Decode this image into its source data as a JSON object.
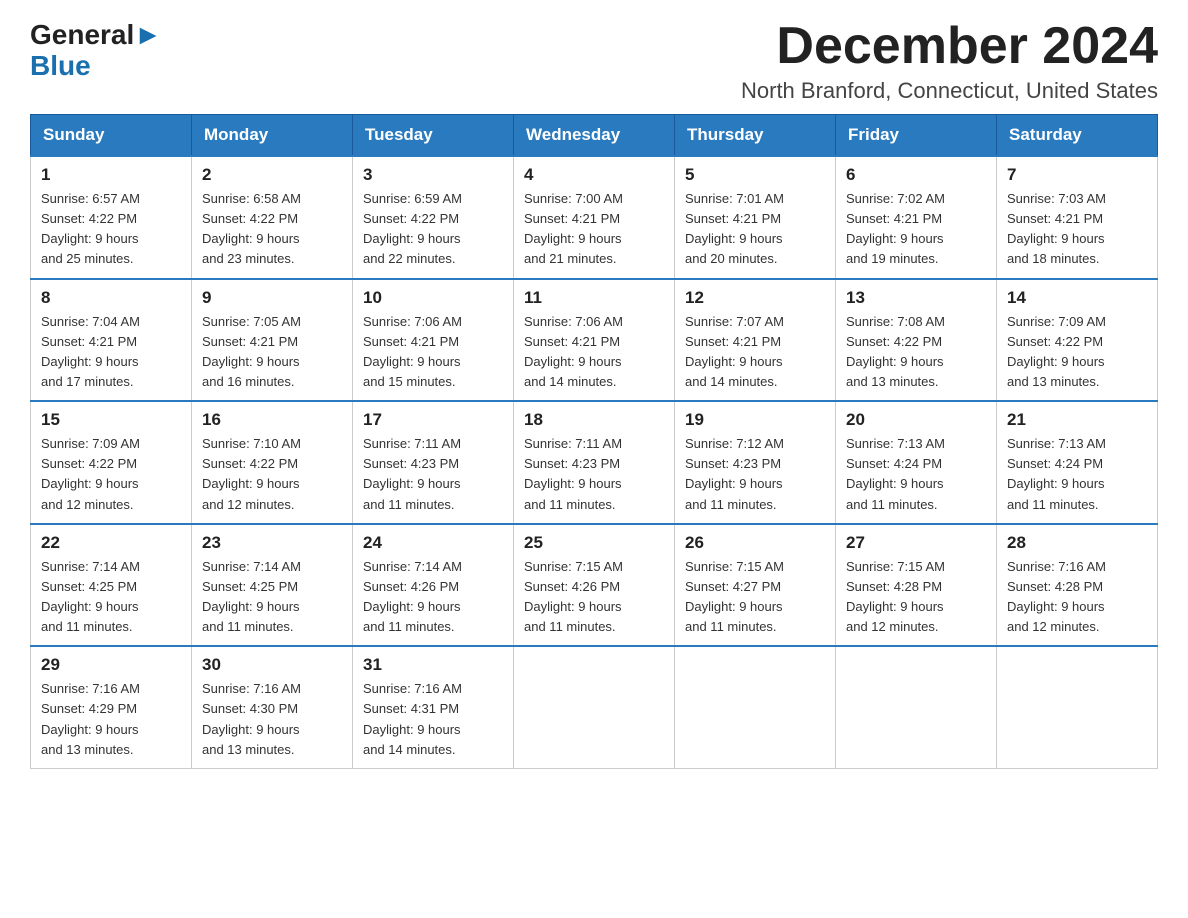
{
  "header": {
    "logo_line1": "General",
    "logo_line2": "Blue",
    "month_title": "December 2024",
    "location": "North Branford, Connecticut, United States"
  },
  "weekdays": [
    "Sunday",
    "Monday",
    "Tuesday",
    "Wednesday",
    "Thursday",
    "Friday",
    "Saturday"
  ],
  "weeks": [
    [
      {
        "day": "1",
        "sunrise": "6:57 AM",
        "sunset": "4:22 PM",
        "daylight": "9 hours and 25 minutes."
      },
      {
        "day": "2",
        "sunrise": "6:58 AM",
        "sunset": "4:22 PM",
        "daylight": "9 hours and 23 minutes."
      },
      {
        "day": "3",
        "sunrise": "6:59 AM",
        "sunset": "4:22 PM",
        "daylight": "9 hours and 22 minutes."
      },
      {
        "day": "4",
        "sunrise": "7:00 AM",
        "sunset": "4:21 PM",
        "daylight": "9 hours and 21 minutes."
      },
      {
        "day": "5",
        "sunrise": "7:01 AM",
        "sunset": "4:21 PM",
        "daylight": "9 hours and 20 minutes."
      },
      {
        "day": "6",
        "sunrise": "7:02 AM",
        "sunset": "4:21 PM",
        "daylight": "9 hours and 19 minutes."
      },
      {
        "day": "7",
        "sunrise": "7:03 AM",
        "sunset": "4:21 PM",
        "daylight": "9 hours and 18 minutes."
      }
    ],
    [
      {
        "day": "8",
        "sunrise": "7:04 AM",
        "sunset": "4:21 PM",
        "daylight": "9 hours and 17 minutes."
      },
      {
        "day": "9",
        "sunrise": "7:05 AM",
        "sunset": "4:21 PM",
        "daylight": "9 hours and 16 minutes."
      },
      {
        "day": "10",
        "sunrise": "7:06 AM",
        "sunset": "4:21 PM",
        "daylight": "9 hours and 15 minutes."
      },
      {
        "day": "11",
        "sunrise": "7:06 AM",
        "sunset": "4:21 PM",
        "daylight": "9 hours and 14 minutes."
      },
      {
        "day": "12",
        "sunrise": "7:07 AM",
        "sunset": "4:21 PM",
        "daylight": "9 hours and 14 minutes."
      },
      {
        "day": "13",
        "sunrise": "7:08 AM",
        "sunset": "4:22 PM",
        "daylight": "9 hours and 13 minutes."
      },
      {
        "day": "14",
        "sunrise": "7:09 AM",
        "sunset": "4:22 PM",
        "daylight": "9 hours and 13 minutes."
      }
    ],
    [
      {
        "day": "15",
        "sunrise": "7:09 AM",
        "sunset": "4:22 PM",
        "daylight": "9 hours and 12 minutes."
      },
      {
        "day": "16",
        "sunrise": "7:10 AM",
        "sunset": "4:22 PM",
        "daylight": "9 hours and 12 minutes."
      },
      {
        "day": "17",
        "sunrise": "7:11 AM",
        "sunset": "4:23 PM",
        "daylight": "9 hours and 11 minutes."
      },
      {
        "day": "18",
        "sunrise": "7:11 AM",
        "sunset": "4:23 PM",
        "daylight": "9 hours and 11 minutes."
      },
      {
        "day": "19",
        "sunrise": "7:12 AM",
        "sunset": "4:23 PM",
        "daylight": "9 hours and 11 minutes."
      },
      {
        "day": "20",
        "sunrise": "7:13 AM",
        "sunset": "4:24 PM",
        "daylight": "9 hours and 11 minutes."
      },
      {
        "day": "21",
        "sunrise": "7:13 AM",
        "sunset": "4:24 PM",
        "daylight": "9 hours and 11 minutes."
      }
    ],
    [
      {
        "day": "22",
        "sunrise": "7:14 AM",
        "sunset": "4:25 PM",
        "daylight": "9 hours and 11 minutes."
      },
      {
        "day": "23",
        "sunrise": "7:14 AM",
        "sunset": "4:25 PM",
        "daylight": "9 hours and 11 minutes."
      },
      {
        "day": "24",
        "sunrise": "7:14 AM",
        "sunset": "4:26 PM",
        "daylight": "9 hours and 11 minutes."
      },
      {
        "day": "25",
        "sunrise": "7:15 AM",
        "sunset": "4:26 PM",
        "daylight": "9 hours and 11 minutes."
      },
      {
        "day": "26",
        "sunrise": "7:15 AM",
        "sunset": "4:27 PM",
        "daylight": "9 hours and 11 minutes."
      },
      {
        "day": "27",
        "sunrise": "7:15 AM",
        "sunset": "4:28 PM",
        "daylight": "9 hours and 12 minutes."
      },
      {
        "day": "28",
        "sunrise": "7:16 AM",
        "sunset": "4:28 PM",
        "daylight": "9 hours and 12 minutes."
      }
    ],
    [
      {
        "day": "29",
        "sunrise": "7:16 AM",
        "sunset": "4:29 PM",
        "daylight": "9 hours and 13 minutes."
      },
      {
        "day": "30",
        "sunrise": "7:16 AM",
        "sunset": "4:30 PM",
        "daylight": "9 hours and 13 minutes."
      },
      {
        "day": "31",
        "sunrise": "7:16 AM",
        "sunset": "4:31 PM",
        "daylight": "9 hours and 14 minutes."
      },
      null,
      null,
      null,
      null
    ]
  ],
  "labels": {
    "sunrise": "Sunrise:",
    "sunset": "Sunset:",
    "daylight": "Daylight:"
  }
}
